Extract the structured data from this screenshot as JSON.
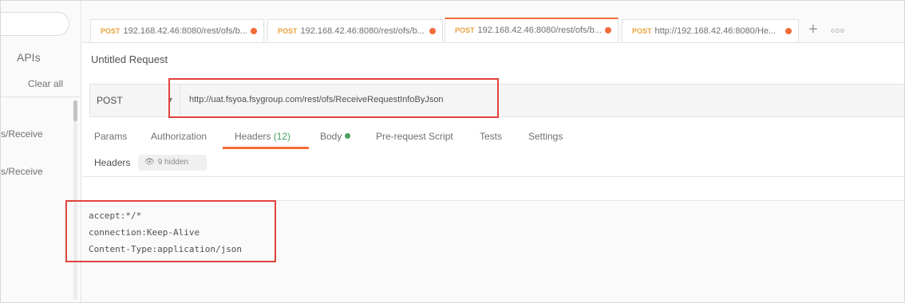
{
  "sidebar": {
    "apis_label": "APIs",
    "clear_all_label": "Clear all",
    "items": [
      "s/Receive",
      "s/Receive"
    ]
  },
  "tabs": [
    {
      "method": "POST",
      "url": "192.168.42.46:8080/rest/ofs/b..."
    },
    {
      "method": "POST",
      "url": "192.168.42.46:8080/rest/ofs/b..."
    },
    {
      "method": "POST",
      "url": "192.168.42.46:8080/rest/ofs/b..."
    },
    {
      "method": "POST",
      "url": "http://192.168.42.46:8080/He..."
    }
  ],
  "tab_add": "+",
  "tab_more": "ooo",
  "request": {
    "title": "Untitled Request",
    "method": "POST",
    "url": "http://uat.fsyoa.fsygroup.com/rest/ofs/ReceiveRequestInfoByJson"
  },
  "subtabs": {
    "params": "Params",
    "authorization": "Authorization",
    "headers": "Headers",
    "headers_count": "(12)",
    "body": "Body",
    "prerequest": "Pre-request Script",
    "tests": "Tests",
    "settings": "Settings"
  },
  "headers_section": {
    "label": "Headers",
    "hidden": "9 hidden"
  },
  "bulk_headers": [
    "accept:*/*",
    "connection:Keep-Alive",
    "Content-Type:application/json"
  ],
  "colors": {
    "accent": "#f26b3a",
    "highlight_box": "#e0443b",
    "method_tab": "#e8a33c",
    "active_green": "#4aa05b"
  }
}
